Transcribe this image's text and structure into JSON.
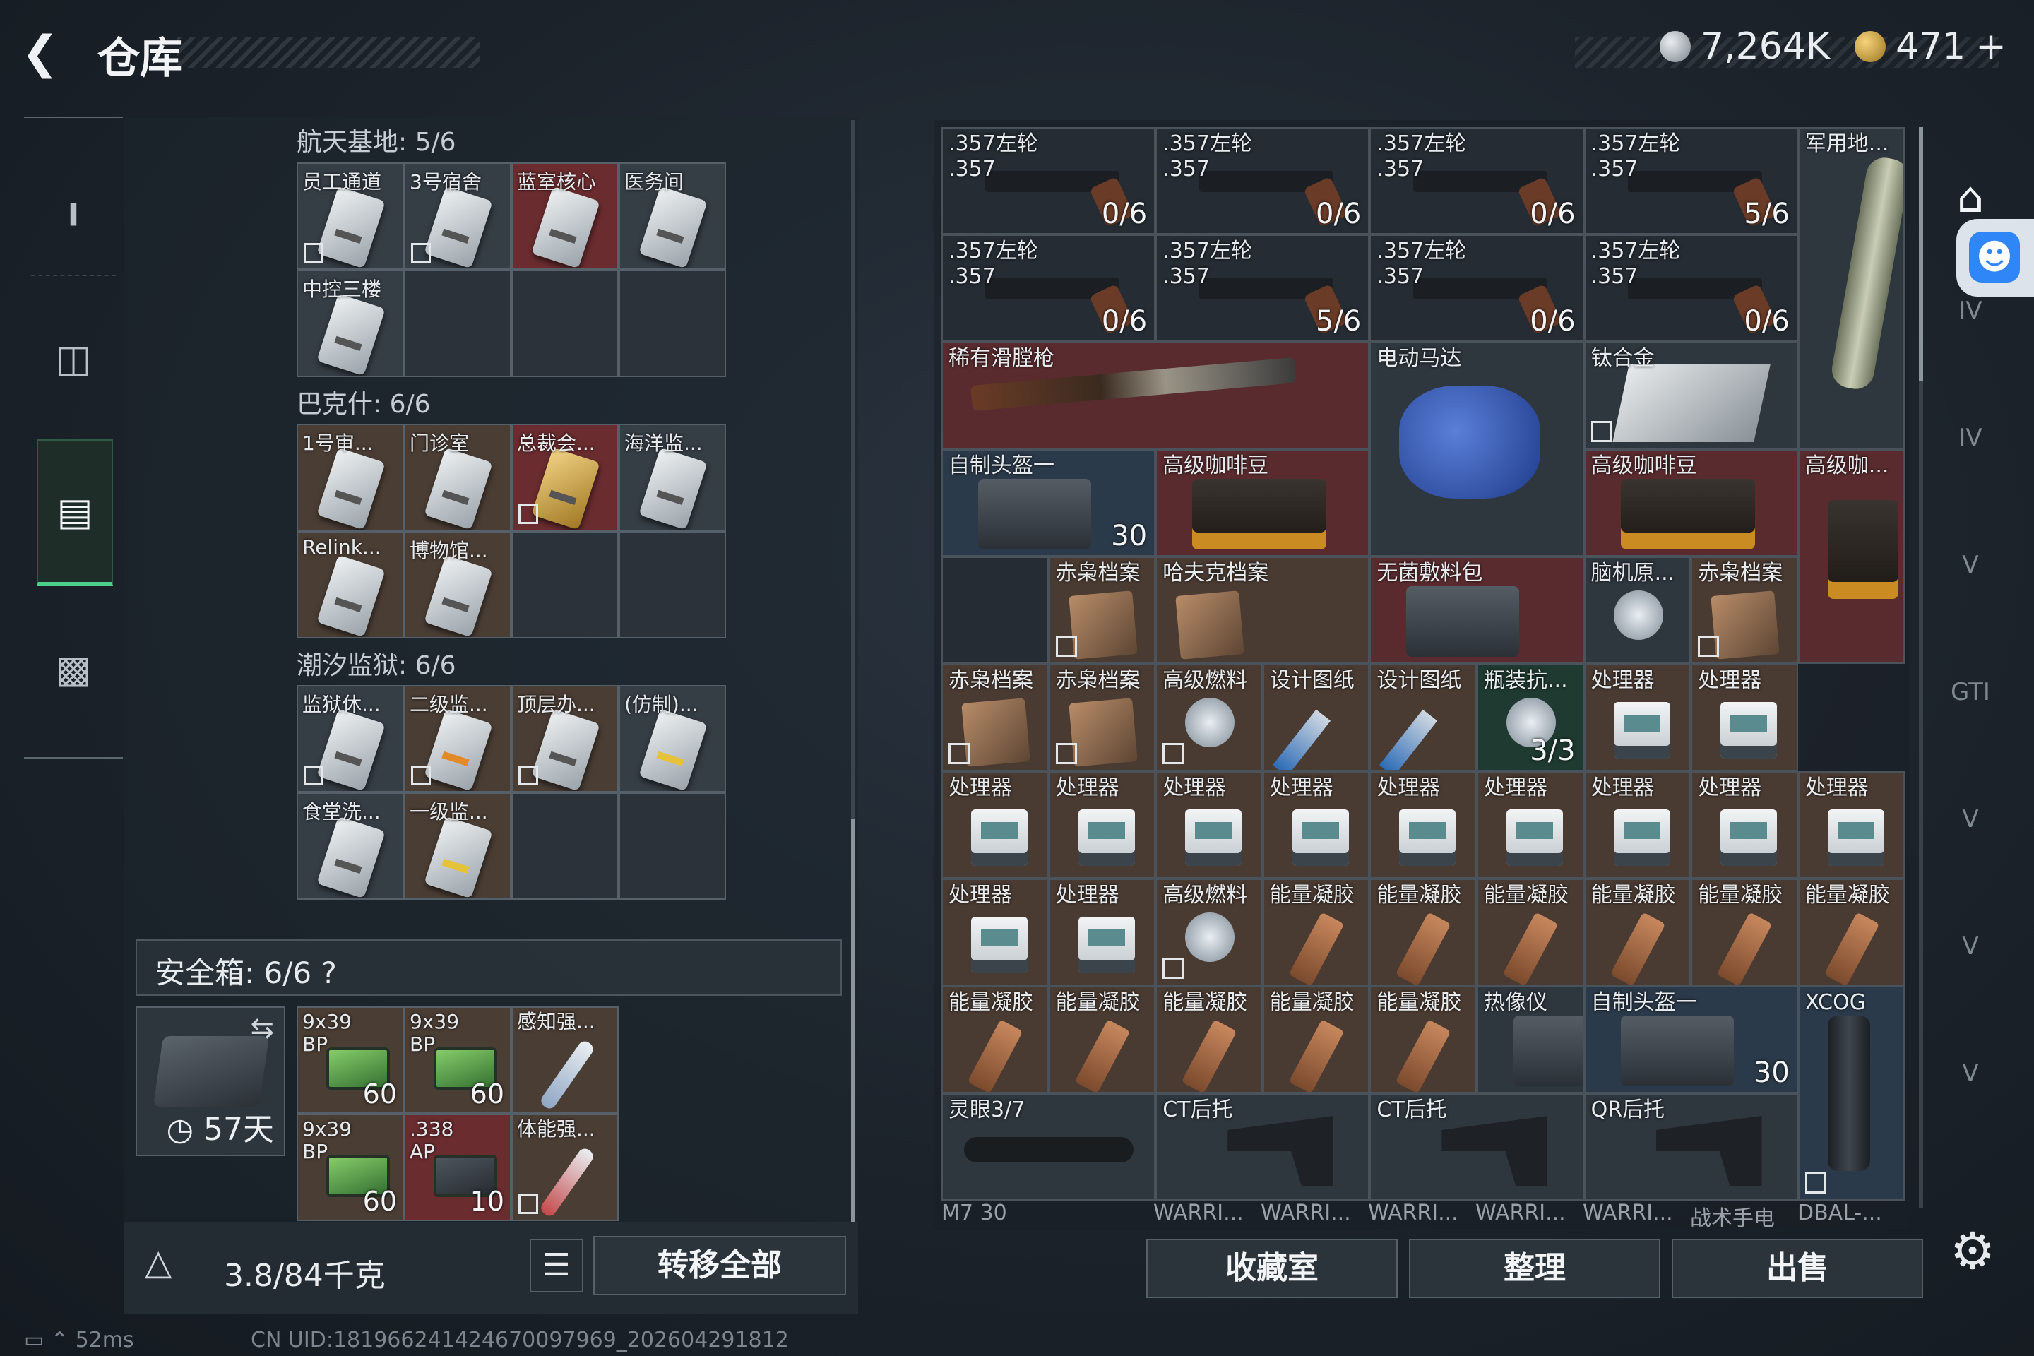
{
  "header": {
    "back_icon": "arrow-left-icon",
    "title": "仓库",
    "currency_silver": "7,264K",
    "currency_gold": "471",
    "gold_add": "+"
  },
  "left_nav": [
    "weapon-icon",
    "backpack-icon",
    "storage-icon",
    "briefcase-icon"
  ],
  "keys": {
    "sections": [
      {
        "title": "航天基地: 5/6",
        "items": [
          {
            "label": "员工通道",
            "bg": "normal",
            "locked": true
          },
          {
            "label": "3号宿舍",
            "bg": "normal",
            "locked": true
          },
          {
            "label": "蓝室核心",
            "bg": "red",
            "locked": false
          },
          {
            "label": "医务间",
            "bg": "normal",
            "locked": false
          },
          {
            "label": "中控三楼",
            "bg": "normal",
            "locked": false
          }
        ]
      },
      {
        "title": "巴克什: 6/6",
        "items": [
          {
            "label": "1号审...",
            "bg": "brown",
            "locked": false
          },
          {
            "label": "门诊室",
            "bg": "brown",
            "locked": false
          },
          {
            "label": "总裁会...",
            "bg": "red",
            "locked": true,
            "card": "gold"
          },
          {
            "label": "海洋监...",
            "bg": "normal",
            "locked": false
          },
          {
            "label": "Relink...",
            "bg": "brown",
            "locked": false
          },
          {
            "label": "博物馆...",
            "bg": "brown",
            "locked": false
          }
        ]
      },
      {
        "title": "潮汐监狱: 6/6",
        "items": [
          {
            "label": "监狱休...",
            "bg": "normal",
            "locked": true
          },
          {
            "label": "二级监...",
            "bg": "brown",
            "locked": true,
            "card": "orange"
          },
          {
            "label": "顶层办...",
            "bg": "brown",
            "locked": true
          },
          {
            "label": "(仿制)...",
            "bg": "normal",
            "locked": false,
            "card": "yellow"
          },
          {
            "label": "食堂洗...",
            "bg": "normal",
            "locked": false
          },
          {
            "label": "一级监...",
            "bg": "brown",
            "locked": false,
            "card": "yellow"
          }
        ]
      }
    ]
  },
  "safe_box": {
    "title": "安全箱:  6/6  ?",
    "duration": "57天",
    "items": [
      {
        "label": "9x39\nBP",
        "qty": "60",
        "kind": "ammo"
      },
      {
        "label": "9x39\nBP",
        "qty": "60",
        "kind": "ammo"
      },
      {
        "label": "感知强...",
        "qty": "",
        "kind": "injector"
      },
      {
        "label": "9x39\nBP",
        "qty": "60",
        "kind": "ammo"
      },
      {
        "label": ".338\nAP",
        "qty": "10",
        "kind": "ammo-dark"
      },
      {
        "label": "体能强...",
        "qty": "",
        "kind": "injector-red",
        "locked": true
      }
    ]
  },
  "bottom_left": {
    "weight_icon": "kg-weight-icon",
    "weight": "3.8/84千克",
    "list_icon": "list-icon",
    "transfer_label": "转移全部"
  },
  "status": {
    "ping": "52ms",
    "uid": "CN UID:181966241424670097969_202604291812"
  },
  "inventory": [
    {
      "label": ".357左轮\n.357",
      "qty": "0/6",
      "art": "gun",
      "bg": "dark",
      "c": 0,
      "r": 0,
      "w": 1,
      "h": 1
    },
    {
      "label": ".357左轮\n.357",
      "qty": "0/6",
      "art": "gun",
      "bg": "dark",
      "c": 1,
      "r": 0,
      "w": 1,
      "h": 1
    },
    {
      "label": ".357左轮\n.357",
      "qty": "0/6",
      "art": "gun",
      "bg": "dark",
      "c": 2,
      "r": 0,
      "w": 1,
      "h": 1
    },
    {
      "label": ".357左轮\n.357",
      "qty": "5/6",
      "art": "gun",
      "bg": "dark",
      "c": 3,
      "r": 0,
      "w": 1,
      "h": 1
    },
    {
      "label": "军用地...",
      "qty": "",
      "art": "tank",
      "bg": "normal",
      "c": 4,
      "r": 0,
      "w": 1,
      "h": 3
    },
    {
      "label": ".357左轮\n.357",
      "qty": "0/6",
      "art": "gun",
      "bg": "dark",
      "c": 0,
      "r": 1,
      "w": 1,
      "h": 1
    },
    {
      "label": ".357左轮\n.357",
      "qty": "5/6",
      "art": "gun",
      "bg": "dark",
      "c": 1,
      "r": 1,
      "w": 1,
      "h": 1
    },
    {
      "label": ".357左轮\n.357",
      "qty": "0/6",
      "art": "gun",
      "bg": "dark",
      "c": 2,
      "r": 1,
      "w": 1,
      "h": 1
    },
    {
      "label": ".357左轮\n.357",
      "qty": "0/6",
      "art": "gun",
      "bg": "dark",
      "c": 3,
      "r": 1,
      "w": 1,
      "h": 1
    },
    {
      "label": "稀有滑膛枪",
      "qty": "",
      "art": "rifle",
      "bg": "red",
      "c": 0,
      "r": 2,
      "w": 2,
      "h": 1
    },
    {
      "label": "电动马达",
      "qty": "",
      "art": "motor",
      "bg": "normal",
      "c": 2,
      "r": 2,
      "w": 1,
      "h": 2
    },
    {
      "label": "钛合金",
      "qty": "",
      "art": "metal",
      "bg": "normal",
      "c": 3,
      "r": 2,
      "w": 1,
      "h": 1,
      "locked": true
    },
    {
      "label": "自制头盔一",
      "qty": "30",
      "art": "bag",
      "bg": "blue",
      "c": 0,
      "r": 3,
      "w": 1,
      "h": 1
    },
    {
      "label": "高级咖啡豆",
      "qty": "",
      "art": "coffee",
      "bg": "red",
      "c": 1,
      "r": 3,
      "w": 1,
      "h": 1
    },
    {
      "label": "高级咖啡豆",
      "qty": "",
      "art": "coffee",
      "bg": "red",
      "c": 3,
      "r": 3,
      "w": 1,
      "h": 1
    },
    {
      "label": "高级咖...",
      "qty": "",
      "art": "coffee-tall",
      "bg": "red",
      "c": 4,
      "r": 3,
      "w": 1,
      "h": 2
    },
    {
      "label": "赤枭档案",
      "qty": "",
      "art": "file",
      "bg": "brown",
      "c": 1,
      "r": 4,
      "w": 1,
      "h": 1,
      "locked": true,
      "half": true
    },
    {
      "label": "哈夫克档案",
      "qty": "",
      "art": "file",
      "bg": "brown",
      "c": 1,
      "r": 4,
      "w": 1,
      "h": 1,
      "offset": true
    },
    {
      "label": "无菌敷料包",
      "qty": "",
      "art": "bag",
      "bg": "red",
      "c": 2,
      "r": 4,
      "w": 1,
      "h": 1
    },
    {
      "label": "脑机原...",
      "qty": "",
      "art": "can",
      "bg": "normal",
      "c": 3,
      "r": 4,
      "w": 1,
      "h": 1,
      "half": true
    },
    {
      "label": "赤枭档案",
      "qty": "",
      "art": "file",
      "bg": "brown",
      "c": 3,
      "r": 4,
      "w": 1,
      "h": 1,
      "locked": true,
      "offset": true
    },
    {
      "label": "赤枭档案",
      "qty": "",
      "art": "file",
      "bg": "brown",
      "c": 0,
      "r": 5,
      "w": 1,
      "h": 1,
      "locked": true
    },
    {
      "label": "赤枭档案",
      "qty": "",
      "art": "file",
      "bg": "brown",
      "c": 1,
      "r": 5,
      "w": 1,
      "h": 1,
      "locked": true
    },
    {
      "label": "高级燃料",
      "qty": "",
      "art": "can",
      "bg": "brown",
      "c": 2,
      "r": 5,
      "w": 1,
      "h": 1,
      "locked": true
    },
    {
      "label": "设计图纸",
      "qty": "",
      "art": "bp",
      "bg": "brown",
      "c": 3,
      "r": 5,
      "w": 1,
      "h": 1
    },
    {
      "label": "设计图纸",
      "qty": "",
      "art": "bp",
      "bg": "brown",
      "c": 4,
      "r": 5,
      "w": 1,
      "h": 1
    },
    {
      "label": "瓶装抗...",
      "qty": "3/3",
      "art": "can",
      "bg": "green",
      "c": 5,
      "r": 5,
      "w": 1,
      "h": 1
    },
    {
      "label": "处理器",
      "qty": "",
      "art": "pr",
      "bg": "brown",
      "c": 6,
      "r": 5,
      "w": 1,
      "h": 1
    },
    {
      "label": "处理器",
      "qty": "",
      "art": "pr",
      "bg": "brown",
      "c": 7,
      "r": 5,
      "w": 1,
      "h": 1
    },
    {
      "label": "处理器",
      "qty": "",
      "art": "pr",
      "bg": "brown",
      "c": 0,
      "r": 6,
      "w": 1,
      "h": 1
    },
    {
      "label": "处理器",
      "qty": "",
      "art": "pr",
      "bg": "brown",
      "c": 1,
      "r": 6,
      "w": 1,
      "h": 1
    },
    {
      "label": "处理器",
      "qty": "",
      "art": "pr",
      "bg": "brown",
      "c": 2,
      "r": 6,
      "w": 1,
      "h": 1
    },
    {
      "label": "处理器",
      "qty": "",
      "art": "pr",
      "bg": "brown",
      "c": 3,
      "r": 6,
      "w": 1,
      "h": 1
    },
    {
      "label": "处理器",
      "qty": "",
      "art": "pr",
      "bg": "brown",
      "c": 4,
      "r": 6,
      "w": 1,
      "h": 1
    },
    {
      "label": "处理器",
      "qty": "",
      "art": "pr",
      "bg": "brown",
      "c": 5,
      "r": 6,
      "w": 1,
      "h": 1
    },
    {
      "label": "处理器",
      "qty": "",
      "art": "pr",
      "bg": "brown",
      "c": 6,
      "r": 6,
      "w": 1,
      "h": 1
    },
    {
      "label": "处理器",
      "qty": "",
      "art": "pr",
      "bg": "brown",
      "c": 7,
      "r": 6,
      "w": 1,
      "h": 1
    },
    {
      "label": "处理器",
      "qty": "",
      "art": "pr",
      "bg": "brown",
      "c": 8,
      "r": 6,
      "w": 1,
      "h": 1
    },
    {
      "label": "处理器",
      "qty": "",
      "art": "pr",
      "bg": "brown",
      "c": 0,
      "r": 7,
      "w": 1,
      "h": 1
    },
    {
      "label": "处理器",
      "qty": "",
      "art": "pr",
      "bg": "brown",
      "c": 1,
      "r": 7,
      "w": 1,
      "h": 1
    },
    {
      "label": "高级燃料",
      "qty": "",
      "art": "can",
      "bg": "brown",
      "c": 2,
      "r": 7,
      "w": 1,
      "h": 1,
      "locked": true
    },
    {
      "label": "能量凝胶",
      "qty": "",
      "art": "gel",
      "bg": "brown",
      "c": 3,
      "r": 7,
      "w": 1,
      "h": 1
    },
    {
      "label": "能量凝胶",
      "qty": "",
      "art": "gel",
      "bg": "brown",
      "c": 4,
      "r": 7,
      "w": 1,
      "h": 1
    },
    {
      "label": "能量凝胶",
      "qty": "",
      "art": "gel",
      "bg": "brown",
      "c": 5,
      "r": 7,
      "w": 1,
      "h": 1
    },
    {
      "label": "能量凝胶",
      "qty": "",
      "art": "gel",
      "bg": "brown",
      "c": 6,
      "r": 7,
      "w": 1,
      "h": 1
    },
    {
      "label": "能量凝胶",
      "qty": "",
      "art": "gel",
      "bg": "brown",
      "c": 7,
      "r": 7,
      "w": 1,
      "h": 1
    },
    {
      "label": "能量凝胶",
      "qty": "",
      "art": "gel",
      "bg": "brown",
      "c": 8,
      "r": 7,
      "w": 1,
      "h": 1
    },
    {
      "label": "能量凝胶",
      "qty": "",
      "art": "gel",
      "bg": "brown",
      "c": 0,
      "r": 8,
      "w": 1,
      "h": 1
    },
    {
      "label": "能量凝胶",
      "qty": "",
      "art": "gel",
      "bg": "brown",
      "c": 1,
      "r": 8,
      "w": 1,
      "h": 1
    },
    {
      "label": "能量凝胶",
      "qty": "",
      "art": "gel",
      "bg": "brown",
      "c": 2,
      "r": 8,
      "w": 1,
      "h": 1
    },
    {
      "label": "能量凝胶",
      "qty": "",
      "art": "gel",
      "bg": "brown",
      "c": 3,
      "r": 8,
      "w": 1,
      "h": 1
    },
    {
      "label": "能量凝胶",
      "qty": "",
      "art": "gel",
      "bg": "brown",
      "c": 4,
      "r": 8,
      "w": 1,
      "h": 1
    },
    {
      "label": "热像仪",
      "qty": "",
      "art": "bag",
      "bg": "normal",
      "c": 5,
      "r": 8,
      "w": 1,
      "h": 1
    },
    {
      "label": "自制头盔一",
      "qty": "30",
      "art": "bag",
      "bg": "blue",
      "c": 6,
      "r": 8,
      "w": 2,
      "h": 1
    },
    {
      "label": "XCOG",
      "qty": "",
      "art": "xcog",
      "bg": "blue",
      "c": 8,
      "r": 8,
      "w": 1,
      "h": 2,
      "locked": true
    },
    {
      "label": "灵眼3/7",
      "qty": "",
      "art": "scope",
      "bg": "normal",
      "c": 0,
      "r": 9,
      "w": 2,
      "h": 1
    },
    {
      "label": "CT后托",
      "qty": "",
      "art": "stock",
      "bg": "normal",
      "c": 2,
      "r": 9,
      "w": 2,
      "h": 1
    },
    {
      "label": "CT后托",
      "qty": "",
      "art": "stock",
      "bg": "normal",
      "c": 4,
      "r": 9,
      "w": 2,
      "h": 1
    },
    {
      "label": "QR后托",
      "qty": "",
      "art": "stock",
      "bg": "normal",
      "c": 6,
      "r": 9,
      "w": 2,
      "h": 1
    }
  ],
  "bottom_strip": [
    "M7 30",
    "WARRI...",
    "WARRI...",
    "WARRI...",
    "WARRI...",
    "WARRI...",
    "战术手电",
    "DBAL-..."
  ],
  "right_nav": [
    "home-icon",
    "IV",
    "IV",
    "V",
    "GTI",
    "V",
    "V",
    "V"
  ],
  "actions": {
    "collection": "收藏室",
    "sort": "整理",
    "sell": "出售"
  },
  "settings_icon": "gear-icon",
  "accessibility_icon": "accessibility-icon"
}
